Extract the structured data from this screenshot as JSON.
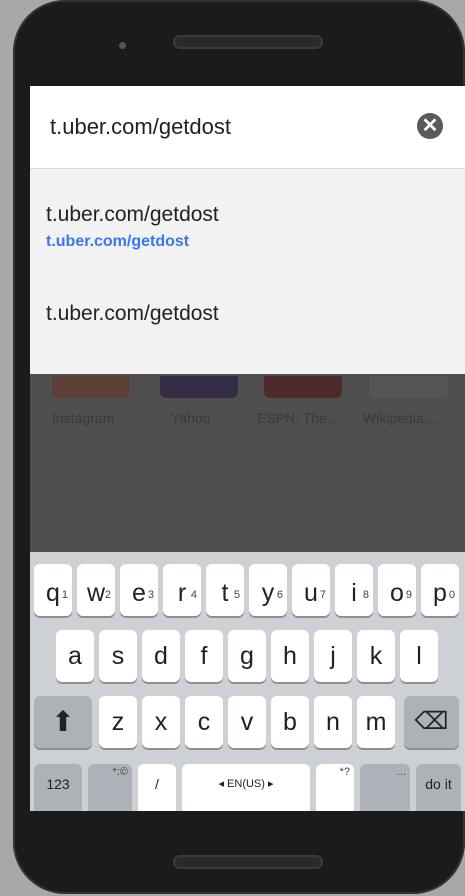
{
  "browser": {
    "url_value": "t.uber.com/getdost",
    "clear_icon_glyph": "✕"
  },
  "suggestions": [
    {
      "title": "t.uber.com/getdost",
      "url": "t.uber.com/getdost"
    },
    {
      "title": "t.uber.com/getdost"
    }
  ],
  "shortcuts": [
    {
      "label": "Instagram",
      "color": "#c0392b"
    },
    {
      "label": "Yahoo",
      "color": "#3d1a7a"
    },
    {
      "label": "ESPN: The...",
      "color": "#8b0000"
    },
    {
      "label": "Wikipedia,...",
      "color": "#9a9a9a"
    }
  ],
  "keyboard": {
    "row1": [
      {
        "key": "q",
        "sup": "1"
      },
      {
        "key": "w",
        "sup": "2"
      },
      {
        "key": "e",
        "sup": "3"
      },
      {
        "key": "r",
        "sup": "4"
      },
      {
        "key": "t",
        "sup": "5"
      },
      {
        "key": "y",
        "sup": "6"
      },
      {
        "key": "u",
        "sup": "7"
      },
      {
        "key": "i",
        "sup": "8"
      },
      {
        "key": "o",
        "sup": "9"
      },
      {
        "key": "p",
        "sup": "0"
      }
    ],
    "row2": [
      "a",
      "s",
      "d",
      "f",
      "g",
      "h",
      "j",
      "k",
      "l"
    ],
    "row3": [
      "z",
      "x",
      "c",
      "v",
      "b",
      "n",
      "m"
    ],
    "shift_glyph": "⬆",
    "backspace_glyph": "⌫",
    "row4": {
      "numbers": "123",
      "emoji_sup": "*:©",
      "comma": "/",
      "language": "◂ EN(US) ▸",
      "punct_sup": "*?",
      "period_sup": "...",
      "enter": "do it"
    }
  }
}
